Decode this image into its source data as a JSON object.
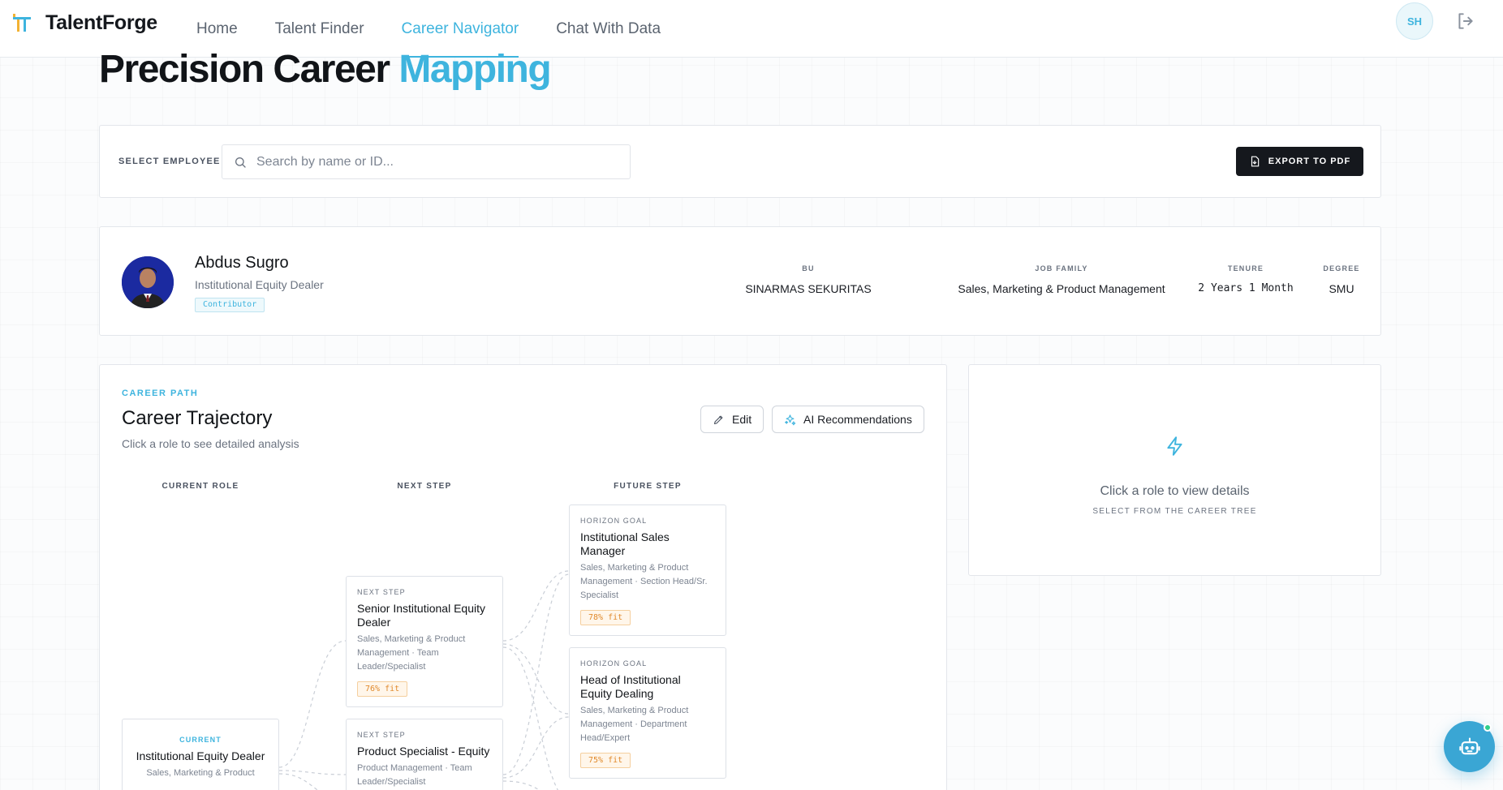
{
  "app": {
    "name": "TalentForge",
    "user_initials": "SH"
  },
  "nav": {
    "items": [
      {
        "label": "Home"
      },
      {
        "label": "Talent Finder"
      },
      {
        "label": "Career Navigator",
        "active": true
      },
      {
        "label": "Chat With Data"
      }
    ]
  },
  "page": {
    "title_main": "Precision Career ",
    "title_accent": "Mapping"
  },
  "employee_select": {
    "label": "SELECT EMPLOYEE",
    "placeholder": "Search by name or ID...",
    "value": "",
    "export_label": "EXPORT TO PDF"
  },
  "profile": {
    "name": "Abdus Sugro",
    "title": "Institutional Equity Dealer",
    "badge": "Contributor",
    "meta": [
      {
        "label": "BU",
        "value": "SINARMAS SEKURITAS"
      },
      {
        "label": "JOB FAMILY",
        "value": "Sales, Marketing & Product Management"
      },
      {
        "label": "TENURE",
        "value": "2 Years 1 Month"
      },
      {
        "label": "DEGREE",
        "value": "SMU"
      }
    ]
  },
  "career_path": {
    "eyebrow": "CAREER PATH",
    "title": "Career Trajectory",
    "subtitle": "Click a role to see detailed analysis",
    "edit_label": "Edit",
    "ai_label": "AI Recommendations",
    "columns": [
      "CURRENT ROLE",
      "NEXT STEP",
      "FUTURE STEP"
    ],
    "current": {
      "kicker": "CURRENT",
      "title": "Institutional Equity Dealer",
      "desc": "Sales, Marketing & Product"
    },
    "next": [
      {
        "kicker": "NEXT STEP",
        "title": "Senior Institutional Equity Dealer",
        "desc": "Sales, Marketing & Product Management · Team Leader/Specialist",
        "fit": "76% fit"
      },
      {
        "kicker": "NEXT STEP",
        "title": "Product Specialist - Equity",
        "desc": "Product Management · Team Leader/Specialist",
        "fit": ""
      }
    ],
    "future": [
      {
        "kicker": "HORIZON GOAL",
        "title": "Institutional Sales Manager",
        "desc": "Sales, Marketing & Product Management · Section Head/Sr. Specialist",
        "fit": "78% fit"
      },
      {
        "kicker": "HORIZON GOAL",
        "title": "Head of Institutional Equity Dealing",
        "desc": "Sales, Marketing & Product Management · Department Head/Expert",
        "fit": "75% fit"
      }
    ]
  },
  "detail_panel": {
    "main": "Click a role to view details",
    "sub": "SELECT FROM THE CAREER TREE"
  },
  "colors": {
    "accent": "#3eb4de",
    "dark": "#15181d",
    "fit": "#e0892b"
  }
}
